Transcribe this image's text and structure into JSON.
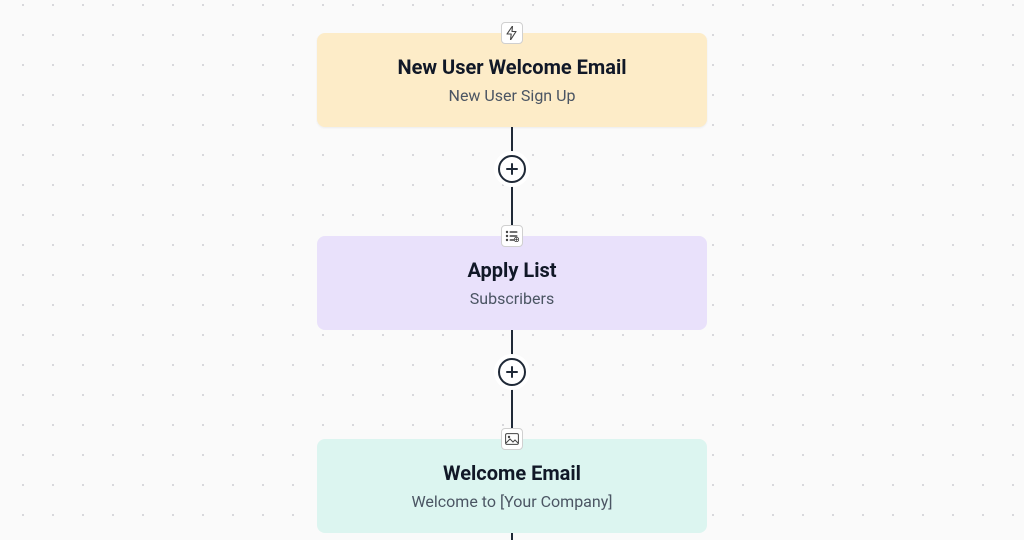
{
  "nodes": {
    "trigger": {
      "title": "New User Welcome Email",
      "subtitle": "New User Sign Up",
      "icon": "lightning-icon",
      "color": "yellow"
    },
    "apply_list": {
      "title": "Apply List",
      "subtitle": "Subscribers",
      "icon": "list-add-icon",
      "color": "purple"
    },
    "welcome_email": {
      "title": "Welcome Email",
      "subtitle": "Welcome to [Your Company]",
      "icon": "image-mail-icon",
      "color": "cyan"
    }
  },
  "add_buttons": {
    "between_1_2": "+",
    "between_2_3": "+"
  }
}
